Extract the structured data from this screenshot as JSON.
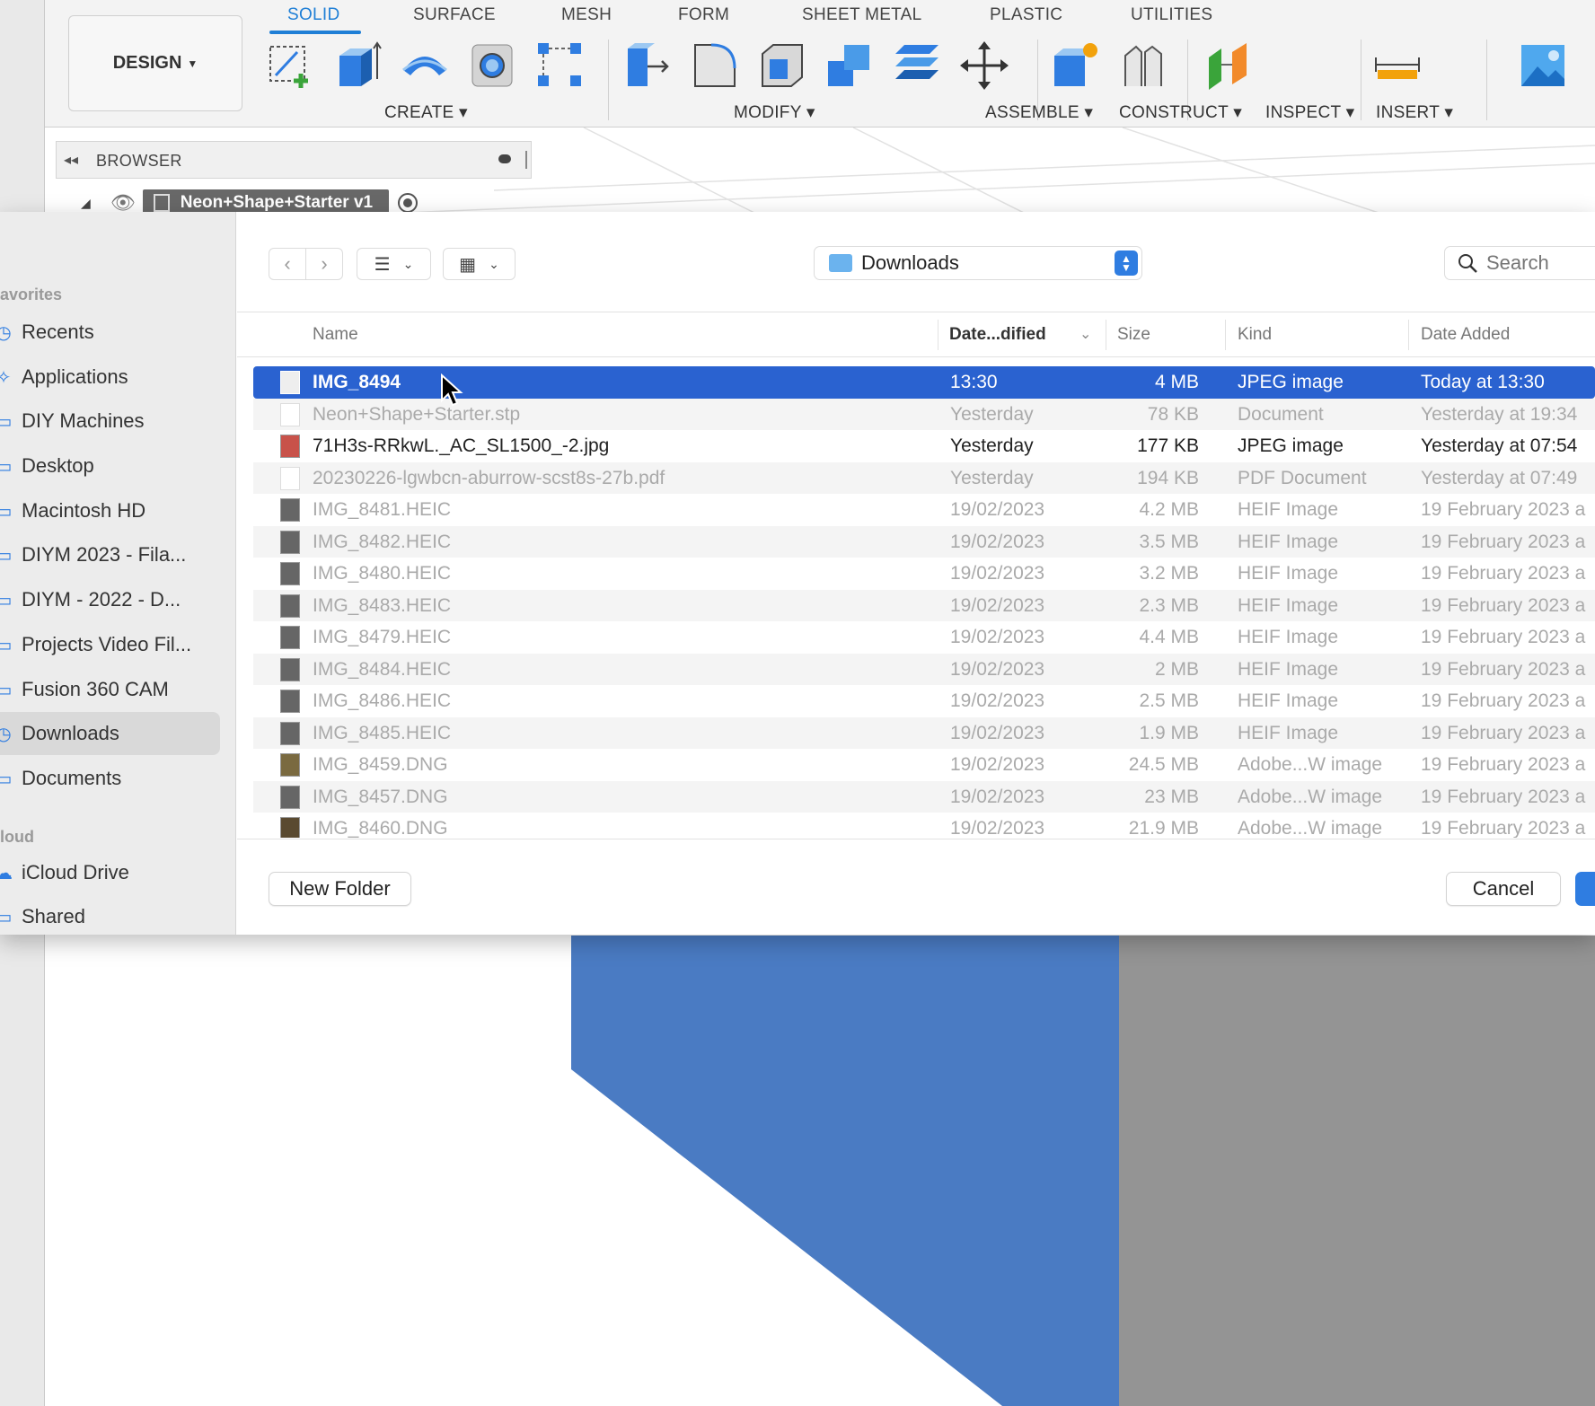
{
  "toolbar": {
    "design_label": "DESIGN",
    "tabs": [
      {
        "label": "SOLID",
        "active": true
      },
      {
        "label": "SURFACE"
      },
      {
        "label": "MESH"
      },
      {
        "label": "FORM"
      },
      {
        "label": "SHEET METAL"
      },
      {
        "label": "PLASTIC"
      },
      {
        "label": "UTILITIES"
      }
    ],
    "groups": [
      {
        "label": "CREATE ▾"
      },
      {
        "label": "MODIFY ▾"
      },
      {
        "label": "ASSEMBLE ▾"
      },
      {
        "label": "CONSTRUCT ▾"
      },
      {
        "label": "INSPECT ▾"
      },
      {
        "label": "INSERT ▾"
      }
    ]
  },
  "browser": {
    "title": "BROWSER",
    "document_name": "Neon+Shape+Starter v1"
  },
  "dialog": {
    "location": "Downloads",
    "search_placeholder": "Search",
    "sidebar": {
      "favorites_heading": "avorites",
      "cloud_heading": "loud",
      "items": [
        {
          "label": "Recents",
          "icon": "clock-icon"
        },
        {
          "label": "Applications",
          "icon": "applications-icon"
        },
        {
          "label": "DIY Machines",
          "icon": "folder-icon"
        },
        {
          "label": "Desktop",
          "icon": "desktop-icon"
        },
        {
          "label": "Macintosh HD",
          "icon": "disk-icon"
        },
        {
          "label": "DIYM 2023 - Fila...",
          "icon": "folder-icon"
        },
        {
          "label": "DIYM - 2022 - D...",
          "icon": "folder-icon"
        },
        {
          "label": "Projects Video Fil...",
          "icon": "folder-icon"
        },
        {
          "label": "Fusion 360 CAM",
          "icon": "folder-icon"
        },
        {
          "label": "Downloads",
          "icon": "downloads-icon",
          "selected": true
        },
        {
          "label": "Documents",
          "icon": "document-icon"
        }
      ],
      "cloud_items": [
        {
          "label": "iCloud Drive",
          "icon": "cloud-icon"
        },
        {
          "label": "Shared",
          "icon": "shared-folder-icon"
        }
      ]
    },
    "columns": {
      "name": "Name",
      "date_modified": "Date...dified",
      "size": "Size",
      "kind": "Kind",
      "date_added": "Date Added"
    },
    "files": [
      {
        "name": "IMG_8494",
        "date": "13:30",
        "size": "4 MB",
        "kind": "JPEG image",
        "added": "Today at 13:30",
        "selected": true
      },
      {
        "name": "Neon+Shape+Starter.stp",
        "date": "Yesterday",
        "size": "78 KB",
        "kind": "Document",
        "added": "Yesterday at 19:34"
      },
      {
        "name": "71H3s-RRkwL._AC_SL1500_-2.jpg",
        "date": "Yesterday",
        "size": "177 KB",
        "kind": "JPEG image",
        "added": "Yesterday at 07:54",
        "active": true
      },
      {
        "name": "20230226-lgwbcn-aburrow-scst8s-27b.pdf",
        "date": "Yesterday",
        "size": "194 KB",
        "kind": "PDF Document",
        "added": "Yesterday at 07:49"
      },
      {
        "name": "IMG_8481.HEIC",
        "date": "19/02/2023",
        "size": "4.2 MB",
        "kind": "HEIF Image",
        "added": "19 February 2023 a"
      },
      {
        "name": "IMG_8482.HEIC",
        "date": "19/02/2023",
        "size": "3.5 MB",
        "kind": "HEIF Image",
        "added": "19 February 2023 a"
      },
      {
        "name": "IMG_8480.HEIC",
        "date": "19/02/2023",
        "size": "3.2 MB",
        "kind": "HEIF Image",
        "added": "19 February 2023 a"
      },
      {
        "name": "IMG_8483.HEIC",
        "date": "19/02/2023",
        "size": "2.3 MB",
        "kind": "HEIF Image",
        "added": "19 February 2023 a"
      },
      {
        "name": "IMG_8479.HEIC",
        "date": "19/02/2023",
        "size": "4.4 MB",
        "kind": "HEIF Image",
        "added": "19 February 2023 a"
      },
      {
        "name": "IMG_8484.HEIC",
        "date": "19/02/2023",
        "size": "2 MB",
        "kind": "HEIF Image",
        "added": "19 February 2023 a"
      },
      {
        "name": "IMG_8486.HEIC",
        "date": "19/02/2023",
        "size": "2.5 MB",
        "kind": "HEIF Image",
        "added": "19 February 2023 a"
      },
      {
        "name": "IMG_8485.HEIC",
        "date": "19/02/2023",
        "size": "1.9 MB",
        "kind": "HEIF Image",
        "added": "19 February 2023 a"
      },
      {
        "name": "IMG_8459.DNG",
        "date": "19/02/2023",
        "size": "24.5 MB",
        "kind": "Adobe...W image",
        "added": "19 February 2023 a"
      },
      {
        "name": "IMG_8457.DNG",
        "date": "19/02/2023",
        "size": "23 MB",
        "kind": "Adobe...W image",
        "added": "19 February 2023 a"
      },
      {
        "name": "IMG_8460.DNG",
        "date": "19/02/2023",
        "size": "21.9 MB",
        "kind": "Adobe...W image",
        "added": "19 February 2023 a"
      }
    ],
    "new_folder_label": "New Folder",
    "cancel_label": "Cancel"
  },
  "colors": {
    "accent": "#2f7de1",
    "selection": "#2a62d0",
    "solid_body": "#4a7bc3"
  }
}
